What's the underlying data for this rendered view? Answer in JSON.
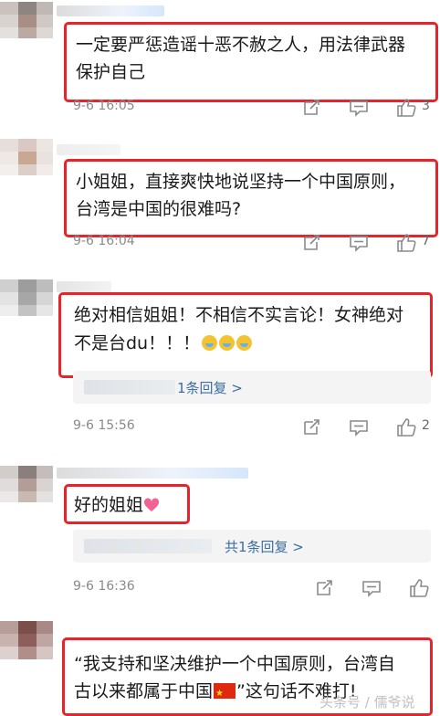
{
  "comments": [
    {
      "text_line1": "一定要严惩造谣十恶不赦之人，用法律武器",
      "text_line2": "保护自己",
      "time": "9-6 16:05",
      "likes": "3"
    },
    {
      "text_line1": "小姐姐，直接爽快地说坚持一个中国原则，",
      "text_line2": "台湾是中国的很难吗?",
      "time": "9-6 16:04",
      "likes": "7"
    },
    {
      "text_line1": "绝对相信姐姐！不相信不实言论！女神绝对",
      "text_line2": "不是台du！！！",
      "reply_label": "1条回复 >",
      "time": "9-6 15:56",
      "likes": "2"
    },
    {
      "text_line1": "好的姐姐",
      "reply_label": "共1条回复 >",
      "time": "9-6 16:36"
    },
    {
      "text_line1": "“我支持和坚决维护一个中国原则，台湾自",
      "text_line2a": "古以来都属于中国",
      "text_line2b": "”这句话不难打!"
    }
  ],
  "watermark": "头条号 / 儒爷说",
  "icons": {
    "share": "share-icon",
    "comment": "comment-icon",
    "like": "thumbs-up-icon"
  },
  "colors": {
    "highlight": "#e8232a",
    "link": "#3a6ea5"
  }
}
